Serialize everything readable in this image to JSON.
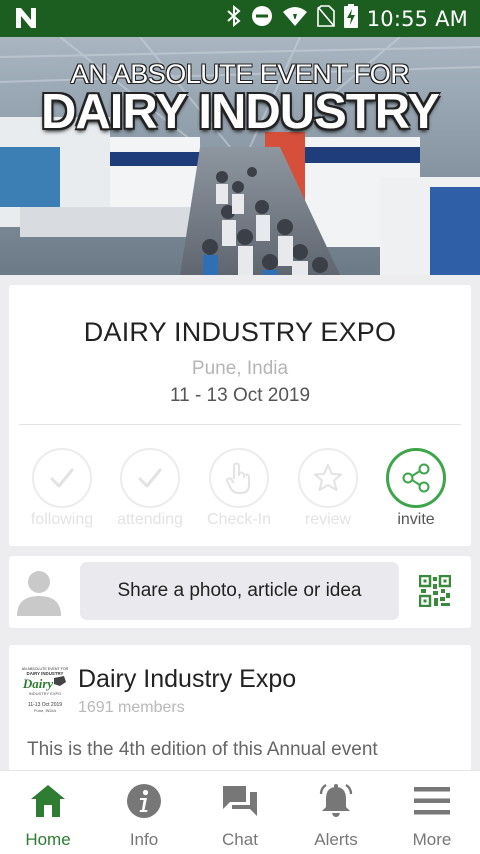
{
  "status_bar": {
    "time": "10:55 AM",
    "icons": [
      "n-logo-icon",
      "bluetooth-icon",
      "do-not-disturb-icon",
      "wifi-icon",
      "no-sim-icon",
      "battery-charging-icon"
    ]
  },
  "banner": {
    "line1": "AN ABSOLUTE EVENT FOR",
    "line2": "DAIRY INDUSTRY"
  },
  "event": {
    "title": "DAIRY INDUSTRY EXPO",
    "location": "Pune, India",
    "dates": "11 - 13 Oct 2019",
    "actions": [
      {
        "label": "following",
        "icon": "check-icon",
        "active": false
      },
      {
        "label": "attending",
        "icon": "check-icon",
        "active": false
      },
      {
        "label": "Check-In",
        "icon": "touch-icon",
        "active": false
      },
      {
        "label": "review",
        "icon": "star-icon",
        "active": false
      },
      {
        "label": "invite",
        "icon": "share-icon",
        "active": true
      }
    ]
  },
  "share": {
    "placeholder": "Share a photo, article or idea"
  },
  "group": {
    "title": "Dairy Industry Expo",
    "members": "1691 members",
    "description": "This is the 4th edition of this Annual event",
    "logo_text": {
      "top": "AN ABSOLUTE EVENT FOR",
      "name1": "DAIRY INDUSTRY",
      "name2": "Dairy",
      "sub": "INDUSTRY EXPO",
      "dates": "11-13 Oct 2019",
      "place": "Pune, INDIA"
    }
  },
  "nav": {
    "items": [
      {
        "label": "Home",
        "icon": "home-icon",
        "active": true
      },
      {
        "label": "Info",
        "icon": "info-icon",
        "active": false
      },
      {
        "label": "Chat",
        "icon": "chat-icon",
        "active": false
      },
      {
        "label": "Alerts",
        "icon": "bell-icon",
        "active": false
      },
      {
        "label": "More",
        "icon": "menu-icon",
        "active": false
      }
    ]
  },
  "colors": {
    "status_bar": "#1b5e20",
    "accent_green": "#3da64a",
    "nav_active": "#2e7d32"
  }
}
